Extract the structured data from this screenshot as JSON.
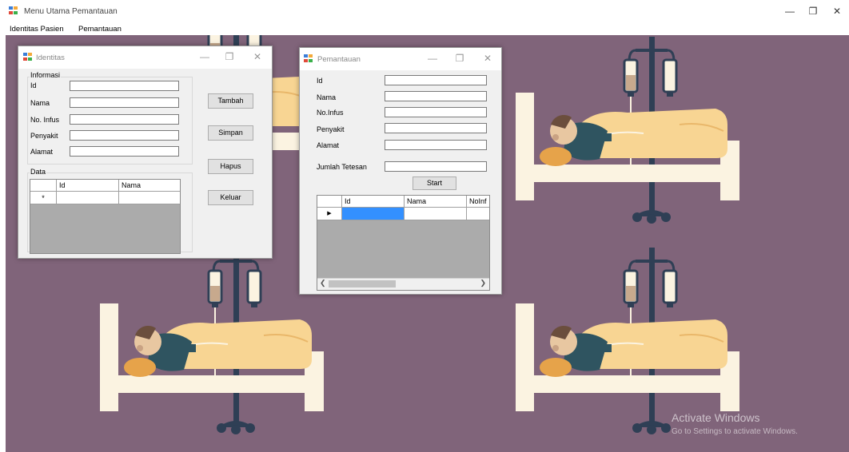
{
  "app": {
    "title": "Menu Utama Pemantauan"
  },
  "menu": {
    "items": [
      "Identitas Pasien",
      "Pemantauan"
    ]
  },
  "window_controls": {
    "minimize": "—",
    "restore": "❐",
    "close": "✕"
  },
  "identitas": {
    "title": "Identitas",
    "group_informasi": "Informasi",
    "labels": {
      "id": "Id",
      "nama": "Nama",
      "no_infus": "No. Infus",
      "penyakit": "Penyakit",
      "alamat": "Alamat"
    },
    "buttons": {
      "tambah": "Tambah",
      "simpan": "Simpan",
      "hapus": "Hapus",
      "keluar": "Keluar"
    },
    "group_data": "Data",
    "grid": {
      "columns": [
        "Id",
        "Nama"
      ],
      "new_row_marker": "*"
    }
  },
  "pemantauan": {
    "title": "Pemantauan",
    "labels": {
      "id": "Id",
      "nama": "Nama",
      "no_infus": "No.Infus",
      "penyakit": "Penyakit",
      "alamat": "Alamat",
      "jumlah_tetesan": "Jumlah Tetesan"
    },
    "buttons": {
      "start": "Start"
    },
    "grid": {
      "columns": [
        "Id",
        "Nama",
        "NoInf"
      ],
      "row_marker": "▶",
      "selected_cell_color": "#3390ff"
    }
  },
  "watermark": {
    "line1": "Activate Windows",
    "line2": "Go to Settings to activate Windows."
  },
  "colors": {
    "desktop": "#80647a",
    "iv_pole": "#2f3f55",
    "blanket": "#f8d593",
    "bed": "#fbf3e1"
  }
}
